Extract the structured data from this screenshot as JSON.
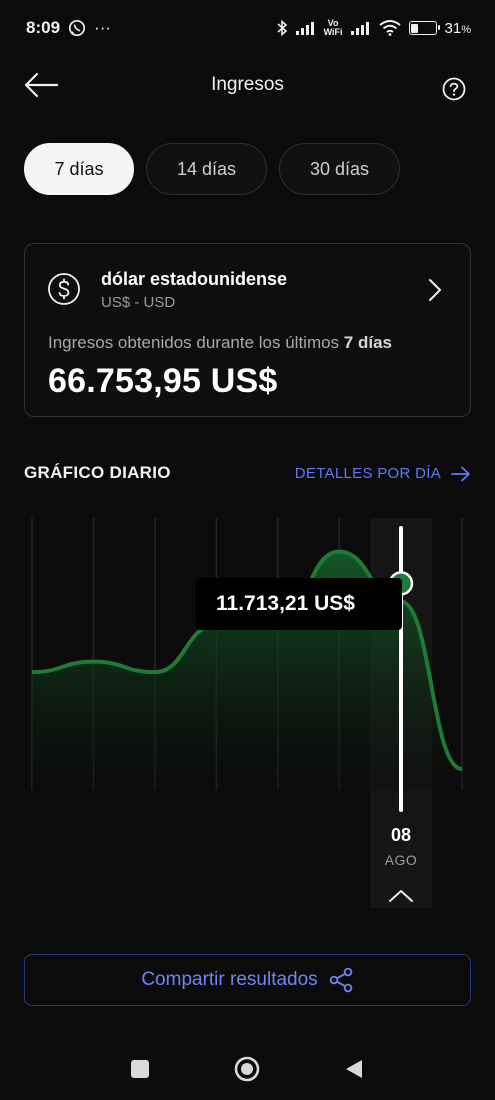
{
  "status_bar": {
    "time": "8:09",
    "vo_wifi_top": "Vo",
    "vo_wifi_bottom": "WiFi",
    "battery_percent": "31",
    "battery_level": 0.31,
    "percent_sign": "%",
    "ellipsis": "···"
  },
  "header": {
    "title": "Ingresos"
  },
  "tabs": [
    {
      "label": "7 días",
      "active": true
    },
    {
      "label": "14 días",
      "active": false
    },
    {
      "label": "30 días",
      "active": false
    }
  ],
  "currency_card": {
    "name": "dólar estadounidense",
    "code": "US$ - USD",
    "earnings_prefix": "Ingresos obtenidos durante los últimos ",
    "earnings_period": "7 días",
    "total": "66.753,95 US$"
  },
  "chart_section": {
    "title": "GRÁFICO DIARIO",
    "details_link": "DETALLES POR DÍA"
  },
  "chart_data": {
    "type": "area",
    "selected_index": 6,
    "selected_value_label": "11.713,21 US$",
    "selected_day": "08",
    "selected_month": "AGO",
    "relative_values": [
      0.45,
      0.49,
      0.45,
      0.63,
      0.65,
      0.91,
      0.72,
      0.08
    ],
    "colors": {
      "line": "#1f7a36",
      "fill_top": "#145c28",
      "marker": "#1e7a3a",
      "cursor": "#ffffff"
    }
  },
  "share": {
    "label": "Compartir resultados"
  },
  "icons": {
    "back": "arrow-left-icon",
    "help": "question-circle-icon",
    "dollar": "dollar-circle-icon",
    "chevron": "chevron-right-icon",
    "details_arrow": "arrow-right-icon",
    "share": "share-icon"
  }
}
